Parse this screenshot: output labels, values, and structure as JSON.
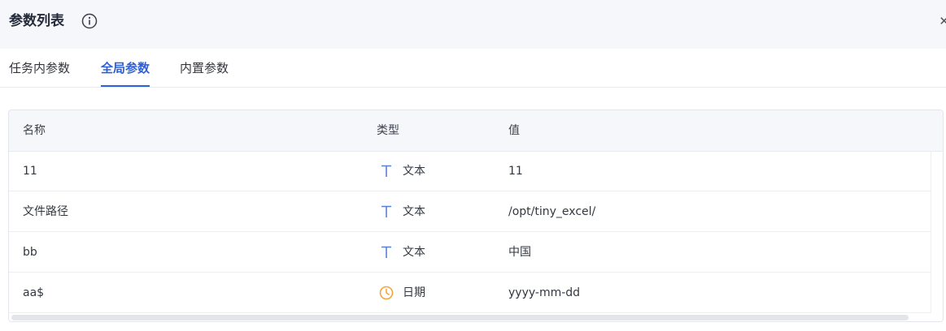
{
  "header": {
    "title": "参数列表",
    "info_icon": "info-icon",
    "close_icon": "close-icon"
  },
  "tabs": [
    {
      "label": "任务内参数",
      "active": false
    },
    {
      "label": "全局参数",
      "active": true
    },
    {
      "label": "内置参数",
      "active": false
    }
  ],
  "table": {
    "columns": {
      "name": "名称",
      "type": "类型",
      "value": "值"
    },
    "rows": [
      {
        "name": "11",
        "type_icon": "text-type-icon",
        "type_label": "文本",
        "value": "11"
      },
      {
        "name": "文件路径",
        "type_icon": "text-type-icon",
        "type_label": "文本",
        "value": "/opt/tiny_excel/"
      },
      {
        "name": "bb",
        "type_icon": "text-type-icon",
        "type_label": "文本",
        "value": "中国"
      },
      {
        "name": "aa$",
        "type_icon": "clock-icon",
        "type_label": "日期",
        "value": "yyyy-mm-dd"
      }
    ]
  },
  "colors": {
    "accent": "#2d5fdc",
    "text_type_icon": "#5b7fd6",
    "date_type_icon": "#f2a63a",
    "header_bg": "#f5f7fb"
  }
}
